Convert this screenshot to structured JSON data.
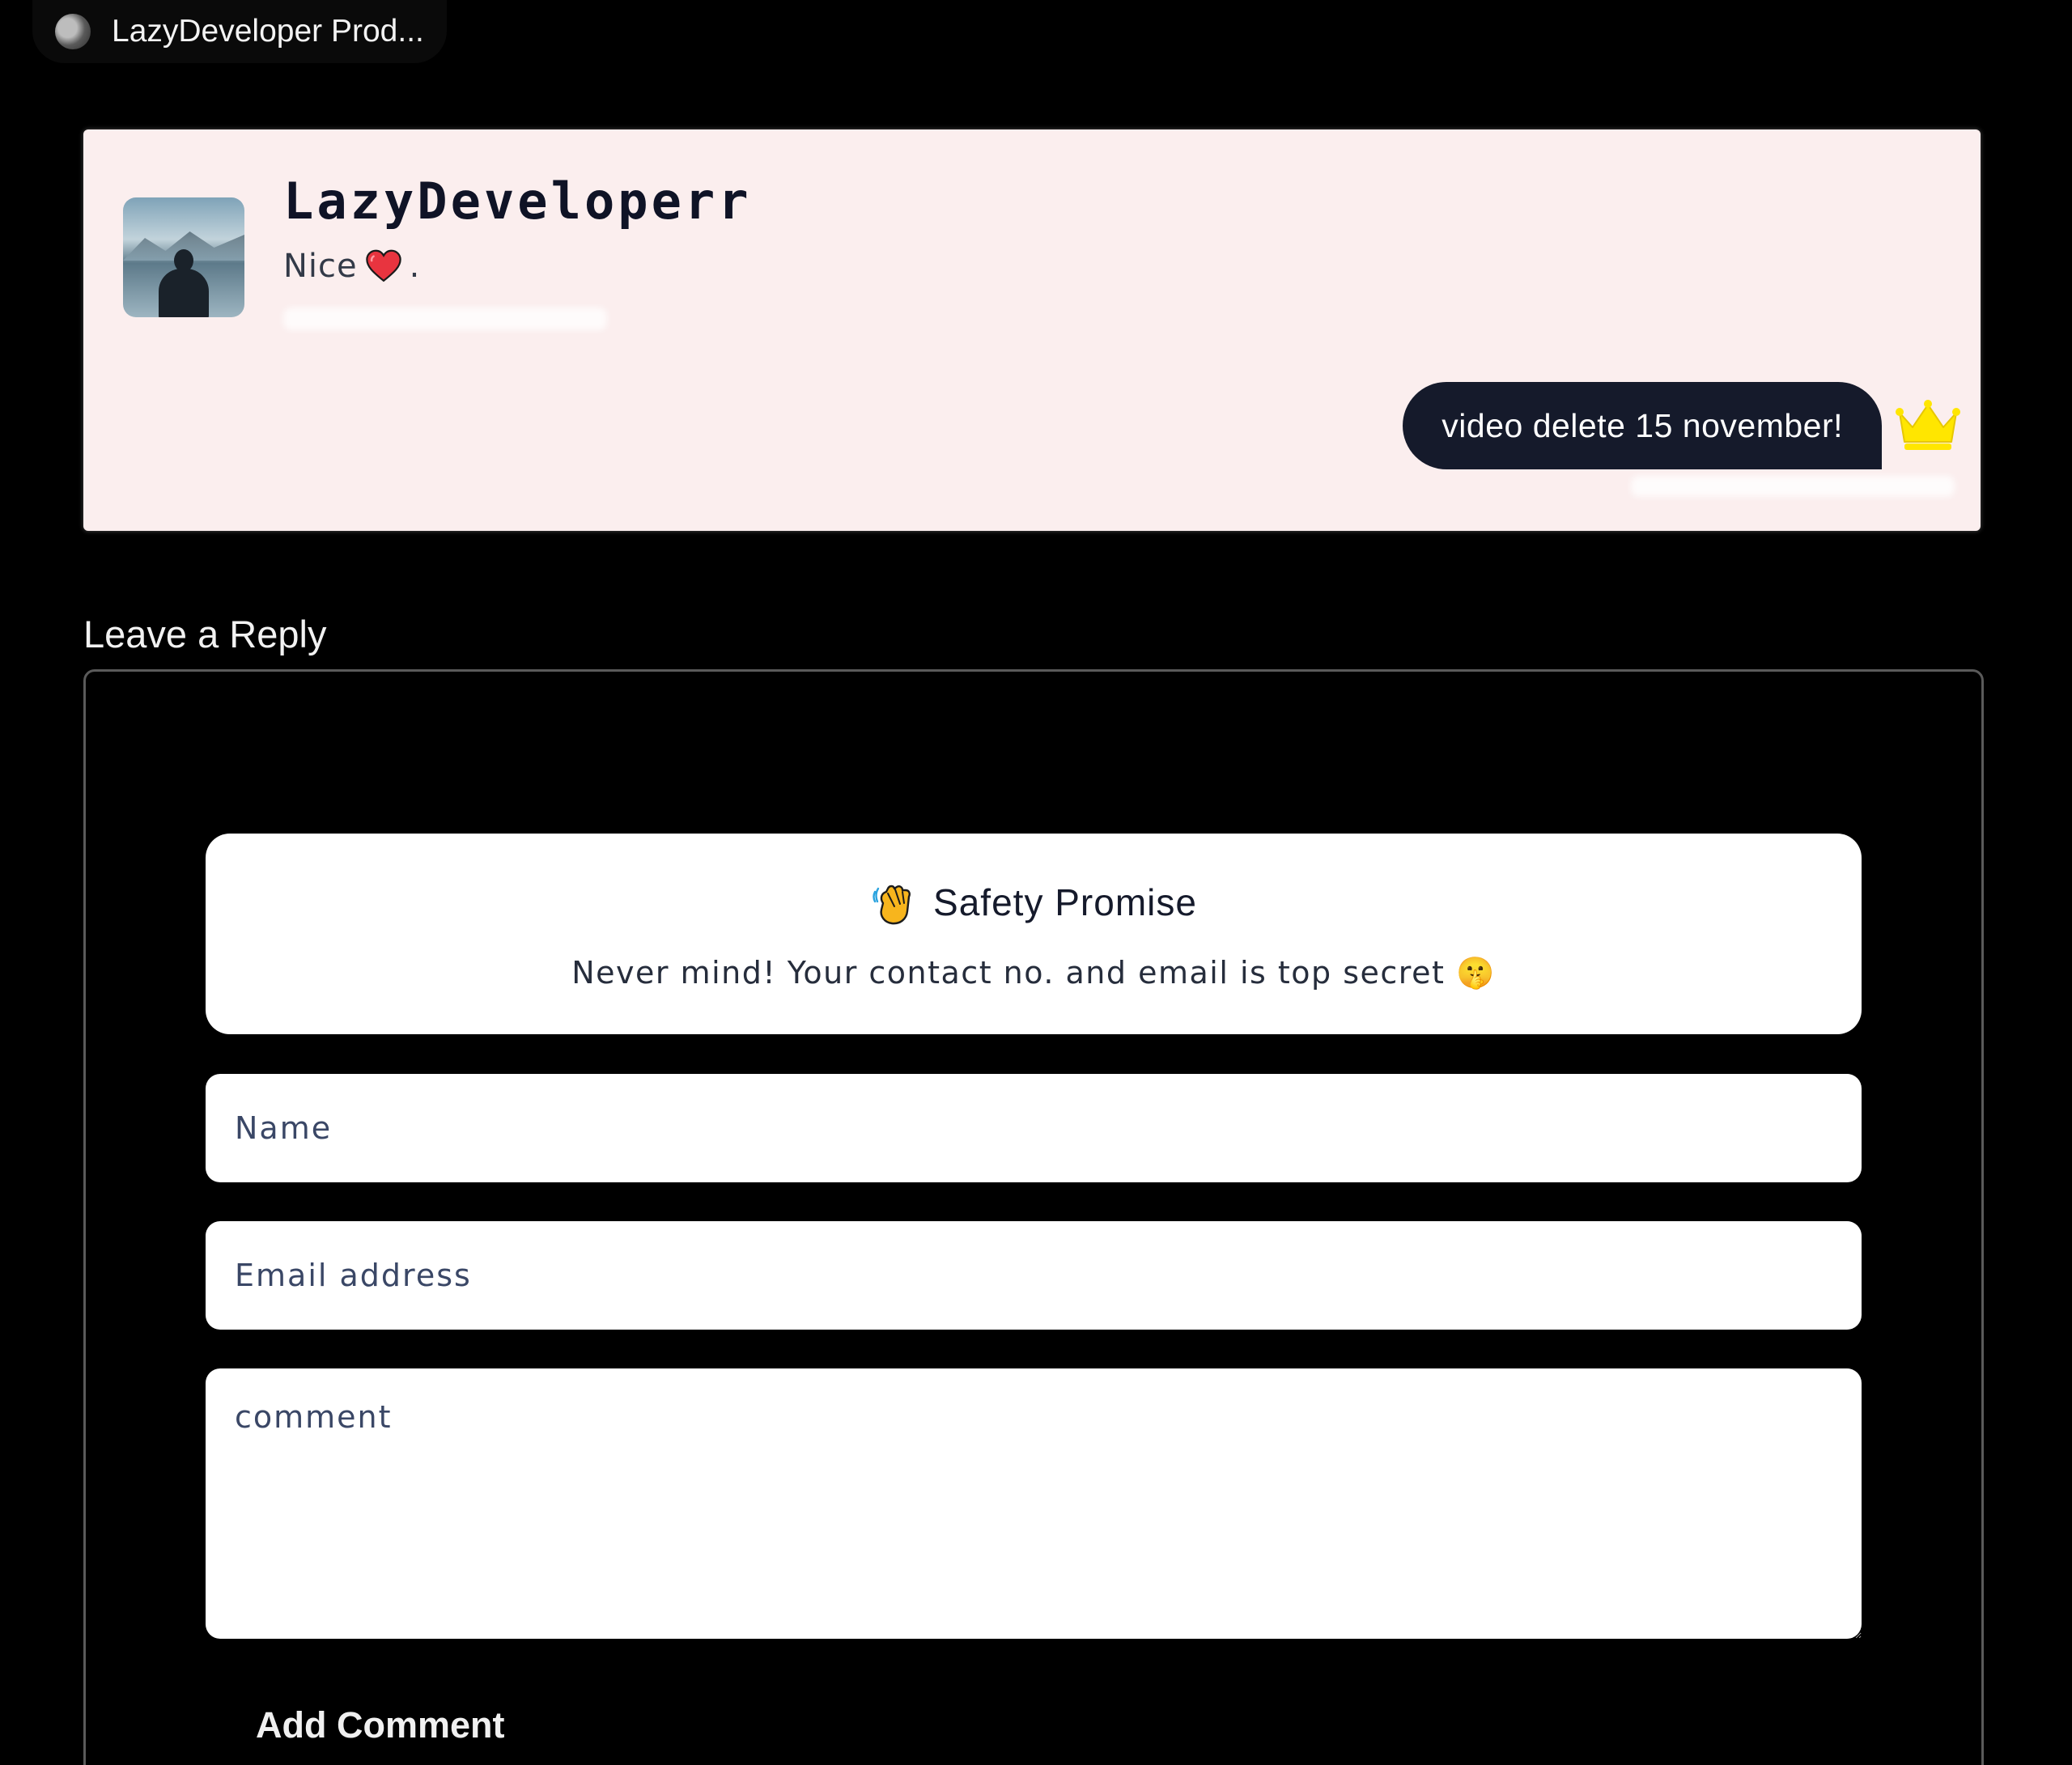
{
  "tab": {
    "title": "LazyDeveloper Prod..."
  },
  "comment": {
    "author": "LazyDeveloperr",
    "text": "Nice",
    "text_suffix": ".",
    "reply": "video delete 15 november!"
  },
  "reply_section": {
    "title": "Leave a Reply",
    "safety": {
      "title": "Safety Promise",
      "text": "Never mind! Your contact no. and email is top secret 🤫"
    },
    "name_placeholder": "Name",
    "email_placeholder": "Email address",
    "comment_placeholder": "comment",
    "submit_label": "Add Comment"
  },
  "colors": {
    "background": "#000000",
    "card": "#fbeeee",
    "bubble": "#151a2b",
    "crown": "#ffe600",
    "heart": "#e8343f"
  },
  "icons": [
    "browser-tab-icon",
    "heart-icon",
    "crown-icon",
    "waving-hand-icon"
  ]
}
